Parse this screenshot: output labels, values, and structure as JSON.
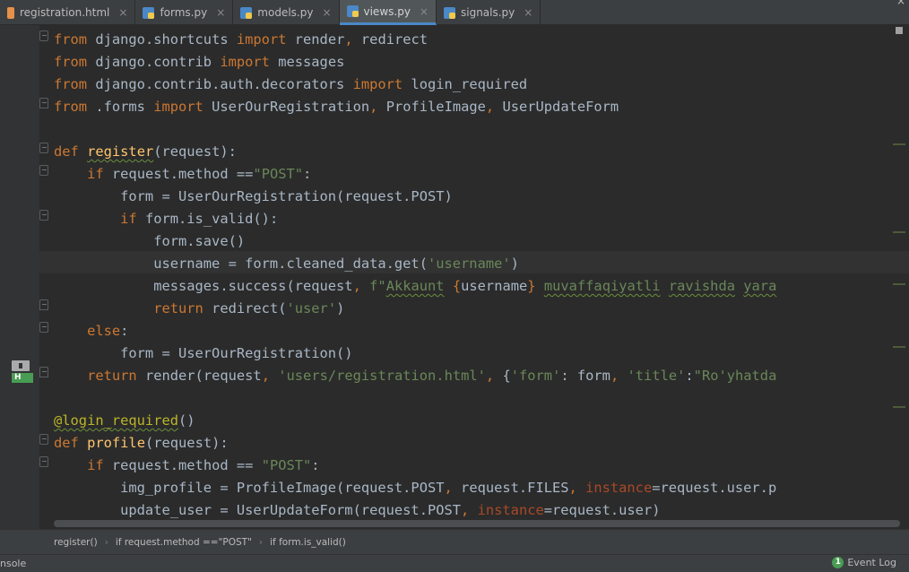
{
  "tabs": [
    {
      "label": "registration.html",
      "type": "html",
      "active": false
    },
    {
      "label": "forms.py",
      "type": "py",
      "active": false
    },
    {
      "label": "models.py",
      "type": "py",
      "active": false
    },
    {
      "label": "views.py",
      "type": "py",
      "active": true
    },
    {
      "label": "signals.py",
      "type": "py",
      "active": false
    }
  ],
  "code_lines": [
    "from django.shortcuts import render, redirect",
    "from django.contrib import messages",
    "from django.contrib.auth.decorators import login_required",
    "from .forms import UserOurRegistration, ProfileImage, UserUpdateForm",
    "",
    "def register(request):",
    "    if request.method ==\"POST\":",
    "        form = UserOurRegistration(request.POST)",
    "        if form.is_valid():",
    "            form.save()",
    "            username = form.cleaned_data.get('username')",
    "            messages.success(request, f\"Akkaunt {username} muvaffaqiyatli ravishda yara",
    "            return redirect('user')",
    "    else:",
    "        form = UserOurRegistration()",
    "    return render(request, 'users/registration.html', {'form': form, 'title':\"Ro'yhatda",
    "",
    "@login_required()",
    "def profile(request):",
    "    if request.method == \"POST\":",
    "        img_profile = ProfileImage(request.POST, request.FILES, instance=request.user.p",
    "        update_user = UserUpdateForm(request.POST, instance=request.user)"
  ],
  "breadcrumb": [
    "register()",
    "if request.method ==\"POST\"",
    "if form.is_valid()"
  ],
  "status": {
    "console_label": "nsole",
    "event_log_label": "Event Log",
    "event_log_count": "1"
  },
  "gutter_icon": {
    "badge": "H"
  },
  "colors": {
    "keyword": "#cc7832",
    "string": "#6a8759",
    "function": "#ffc66d",
    "decorator": "#bbb529",
    "param": "#aa4926",
    "text": "#a9b7c6",
    "background": "#2b2b2b"
  },
  "window_close": "×",
  "tab_close": "×"
}
